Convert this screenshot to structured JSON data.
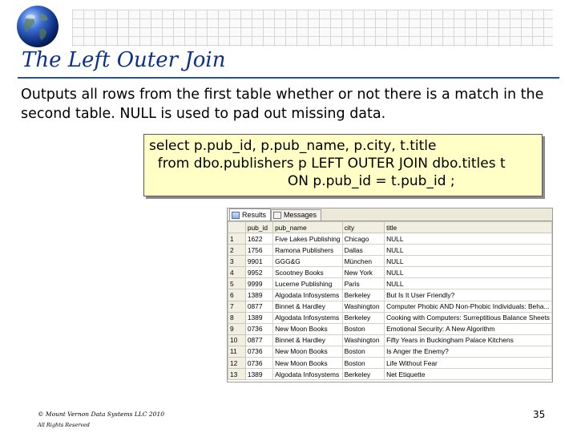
{
  "slide": {
    "title": "The Left Outer Join",
    "body": "Outputs all rows from the first table whether or not there is a match in the second table. NULL is used to pad out missing data.",
    "sql_lines": [
      "select p.pub_id, p.pub_name, p.city, t.title",
      "  from dbo.publishers p LEFT OUTER JOIN dbo.titles t",
      "                                ON p.pub_id = t.pub_id ;"
    ],
    "footer_copyright": "© Mount Vernon Data Systems LLC 2010",
    "footer_rights": "All Rights Reserved",
    "page_number": "35"
  },
  "results": {
    "tabs": [
      {
        "label": "Results",
        "icon": "grid-icon",
        "active": true
      },
      {
        "label": "Messages",
        "icon": "messages-icon",
        "active": false
      }
    ],
    "columns": [
      "pub_id",
      "pub_name",
      "city",
      "title"
    ],
    "rows": [
      [
        "1",
        "1622",
        "Five Lakes Publishing",
        "Chicago",
        "NULL"
      ],
      [
        "2",
        "1756",
        "Ramona Publishers",
        "Dallas",
        "NULL"
      ],
      [
        "3",
        "9901",
        "GGG&G",
        "München",
        "NULL"
      ],
      [
        "4",
        "9952",
        "Scootney Books",
        "New York",
        "NULL"
      ],
      [
        "5",
        "9999",
        "Lucerne Publishing",
        "Paris",
        "NULL"
      ],
      [
        "6",
        "1389",
        "Algodata Infosystems",
        "Berkeley",
        "But Is It User Friendly?"
      ],
      [
        "7",
        "0877",
        "Binnet & Hardley",
        "Washington",
        "Computer Phobic AND Non-Phobic Individuals: Beha..."
      ],
      [
        "8",
        "1389",
        "Algodata Infosystems",
        "Berkeley",
        "Cooking with Computers: Surreptitious Balance Sheets"
      ],
      [
        "9",
        "0736",
        "New Moon Books",
        "Boston",
        "Emotional Security: A New Algorithm"
      ],
      [
        "10",
        "0877",
        "Binnet & Hardley",
        "Washington",
        "Fifty Years in Buckingham Palace Kitchens"
      ],
      [
        "11",
        "0736",
        "New Moon Books",
        "Boston",
        "Is Anger the Enemy?"
      ],
      [
        "12",
        "0736",
        "New Moon Books",
        "Boston",
        "Life Without Fear"
      ],
      [
        "13",
        "1389",
        "Algodata Infosystems",
        "Berkeley",
        "Net Etiquette"
      ]
    ]
  }
}
